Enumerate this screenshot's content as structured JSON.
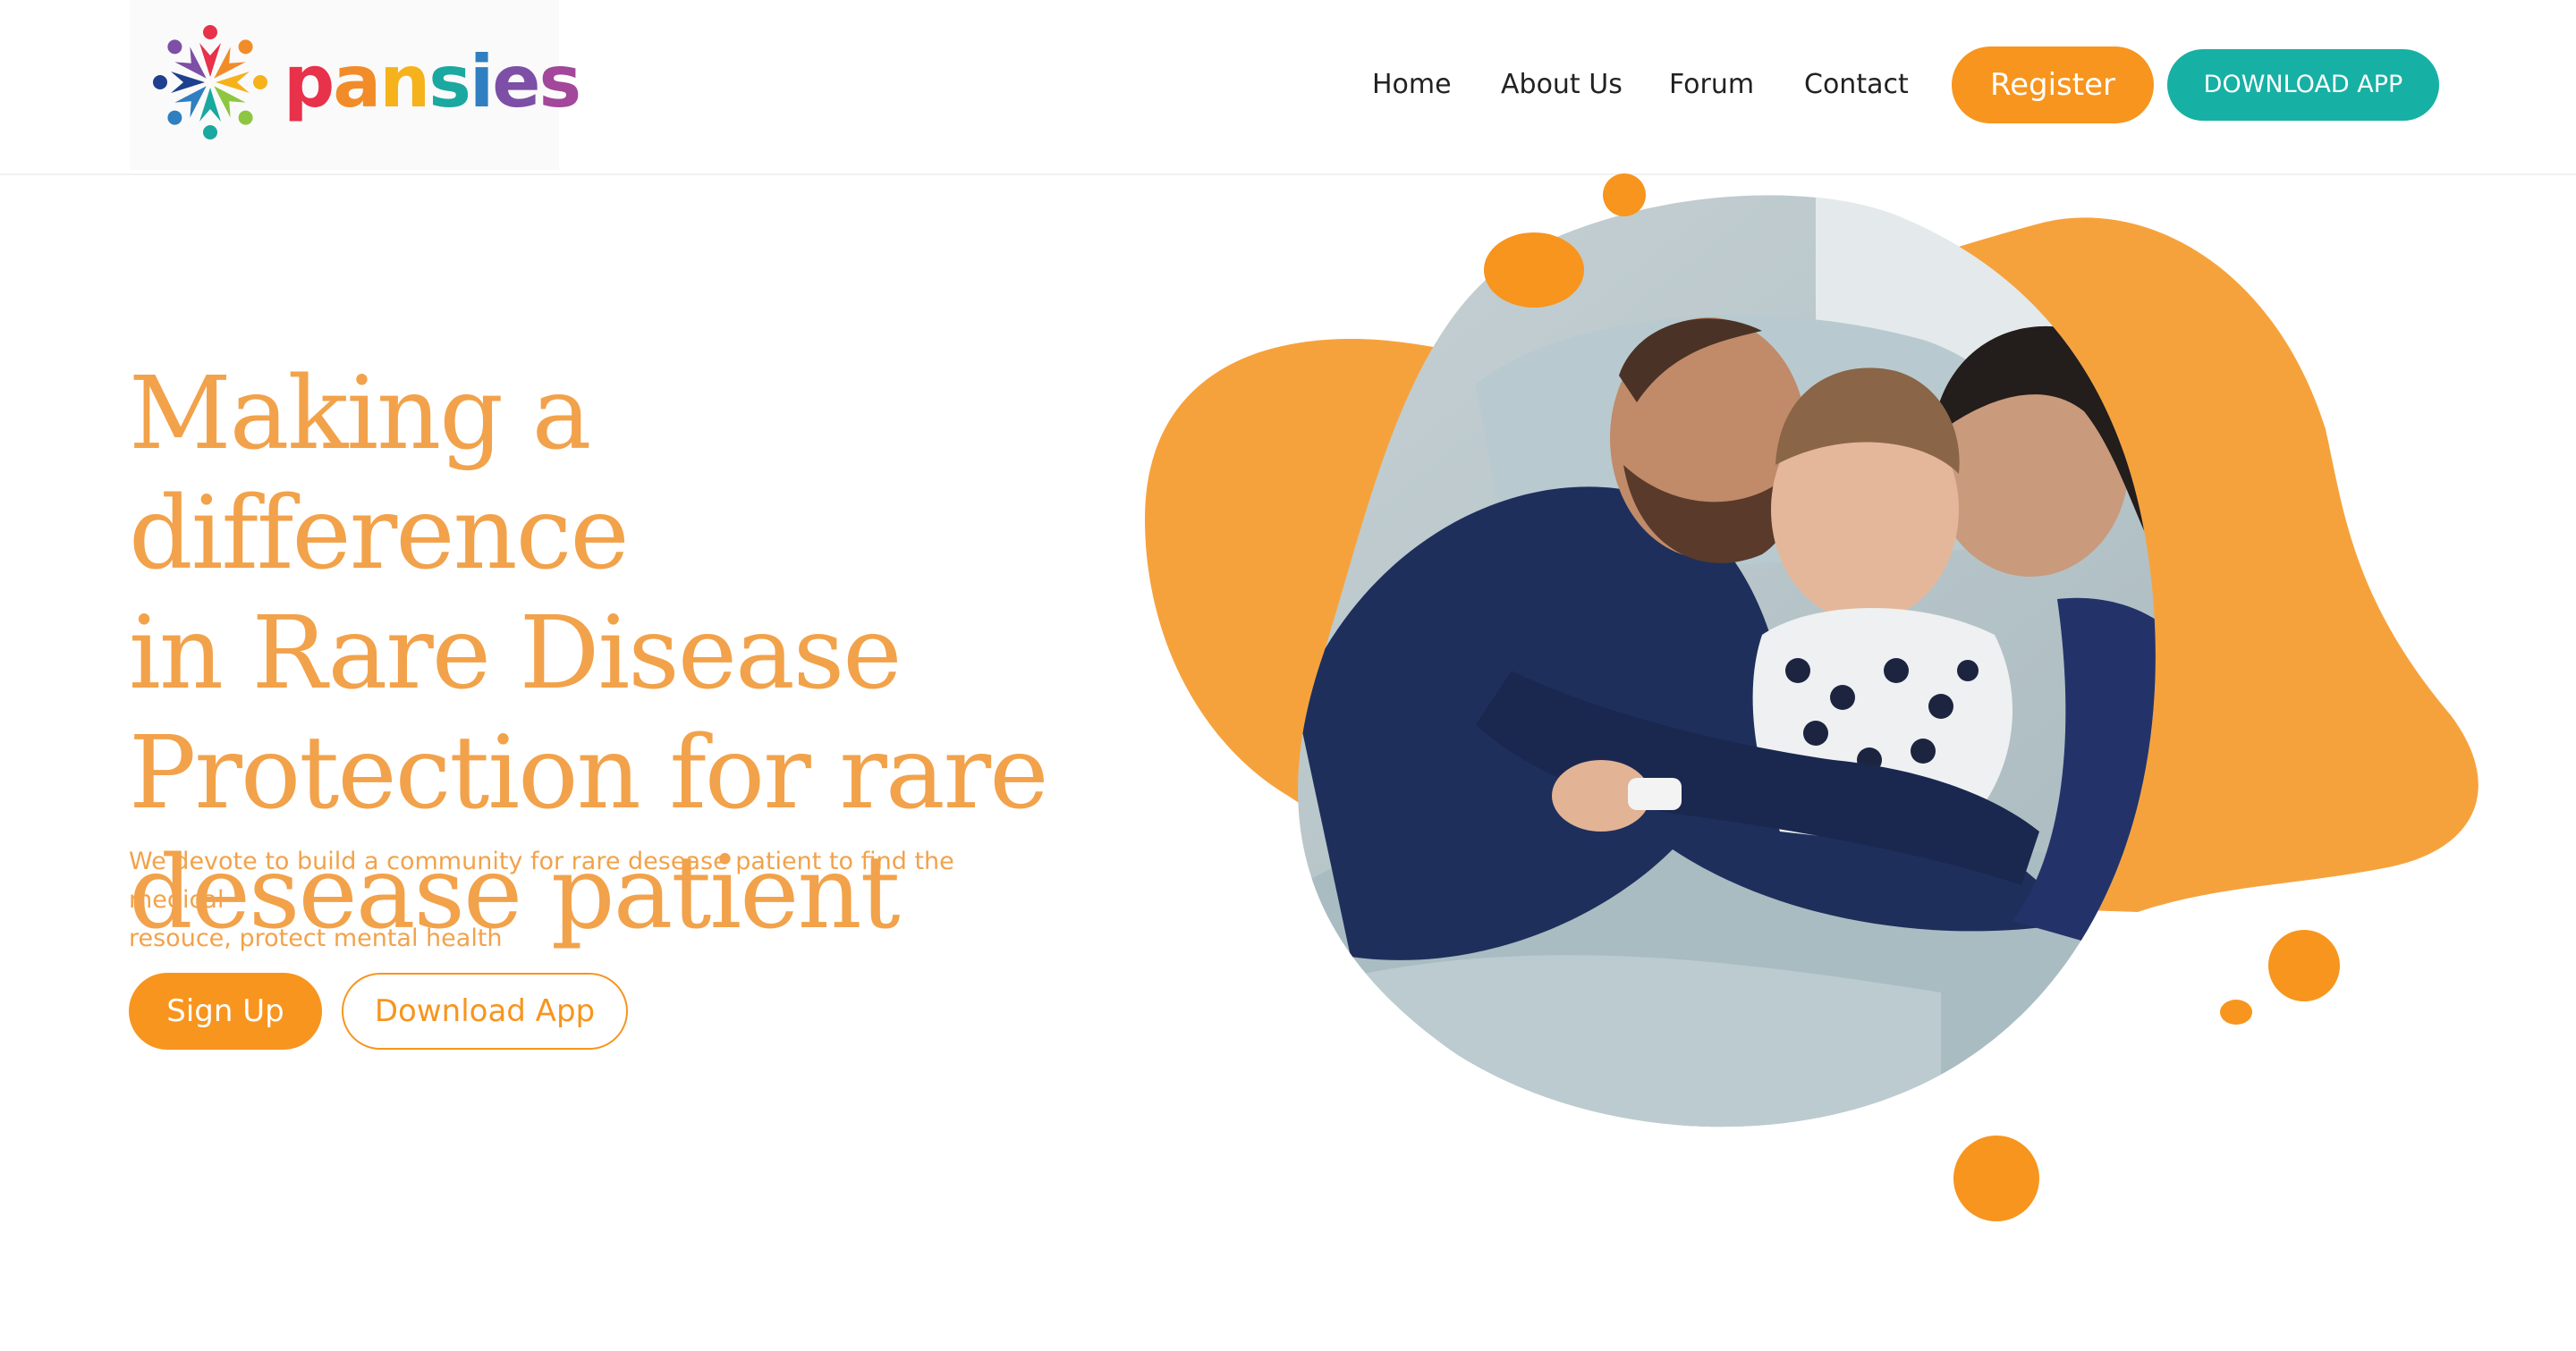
{
  "brand": {
    "name_letters": [
      {
        "ch": "p",
        "color": "#e8314a"
      },
      {
        "ch": "a",
        "color": "#f28c28"
      },
      {
        "ch": "n",
        "color": "#f5b21b"
      },
      {
        "ch": "s",
        "color": "#1aa8a0"
      },
      {
        "ch": "i",
        "color": "#2f7fc1"
      },
      {
        "ch": "e",
        "color": "#7d4fa6"
      },
      {
        "ch": "s",
        "color": "#a2479a"
      }
    ],
    "logo_petal_colors": [
      "#e8314a",
      "#f28c28",
      "#f5b21b",
      "#8dc63f",
      "#1aa8a0",
      "#2f7fc1",
      "#1f3f8f",
      "#7d4fa6"
    ]
  },
  "nav": {
    "home": "Home",
    "about": "About Us",
    "forum": "Forum",
    "contact": "Contact",
    "register": "Register",
    "download_app": "DOWNLOAD APP"
  },
  "hero": {
    "title_lines": [
      "Making a difference",
      "in Rare Disease",
      "Protection for rare",
      "desease patient"
    ],
    "subtitle_lines": [
      "We devote to build a community for rare desease patient to find the medical",
      "resouce, protect mental health"
    ],
    "signup": "Sign Up",
    "download_app": "Download App"
  },
  "colors": {
    "accent_orange": "#f7951e",
    "title_orange": "#f2a24a",
    "teal": "#17b0a4",
    "blob_orange": "#f6a23c"
  },
  "icons": {
    "logo": "pansies-flower-people-icon"
  }
}
